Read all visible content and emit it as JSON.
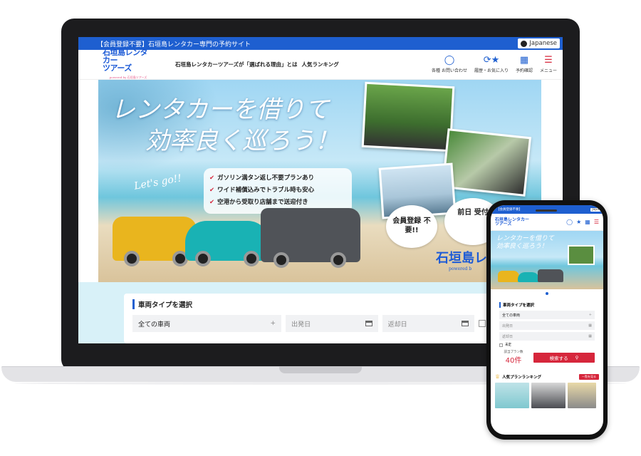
{
  "laptop": {
    "topbar": {
      "notice": "【会員登録不要】石垣島レンタカー専門の予約サイト",
      "language": "Japanese"
    },
    "header": {
      "logo_line1": "石垣島レンタカー",
      "logo_line2": "ツアーズ",
      "logo_tagline": "powered by 石垣島ツアーズ",
      "nav_text": "石垣島レンタカーツアーズが「選ばれる理由」とは",
      "nav_ranking": "人気ランキング",
      "icons": [
        {
          "icon": "chat-icon",
          "label": "各種 お問い合わせ"
        },
        {
          "icon": "history-star-icon",
          "label": "履歴・お気に入り"
        },
        {
          "icon": "calendar-icon",
          "label": "予約確認"
        },
        {
          "icon": "menu-icon",
          "label": "メニュー"
        }
      ]
    },
    "hero": {
      "headline_line1": "レンタカーを借りて",
      "headline_line2": "効率良く巡ろう！",
      "lets_go": "Let's go!!",
      "features": [
        "ガソリン満タン返し不要プランあり",
        "ワイド補償込みでトラブル時も安心",
        "空港から受取り店舗まで送迎付き"
      ],
      "badge_no_member": "会員登録 不要!!",
      "badge_day_before": "前日 受付",
      "brand": "石垣島レン",
      "brand_sub": "powered b"
    },
    "search": {
      "title": "車両タイプを選択",
      "vehicle_value": "全ての車両",
      "departure_placeholder": "出発日",
      "return_placeholder": "返却日"
    }
  },
  "phone": {
    "topbar": {
      "notice": "【会員登録不要】",
      "language": "Japa"
    },
    "logo_line1": "石垣島レンタカー",
    "logo_line2": "ツアーズ",
    "headline_line1": "レンタカーを借りて",
    "headline_line2": "効率良く巡ろう！",
    "search": {
      "title": "車両タイプを選択",
      "vehicle_value": "全ての車両",
      "departure_placeholder": "出発日",
      "return_placeholder": "返却日",
      "undecided": "未定",
      "plan_count_label": "該当プラン数",
      "plan_count": "40件",
      "search_button": "検索する"
    },
    "ranking": {
      "title": "人気プランランキング",
      "more": "一覧を見る"
    }
  },
  "colors": {
    "brand_blue": "#1e5fd0",
    "accent_red": "#d6263b",
    "light_aqua": "#d8f1f8"
  }
}
